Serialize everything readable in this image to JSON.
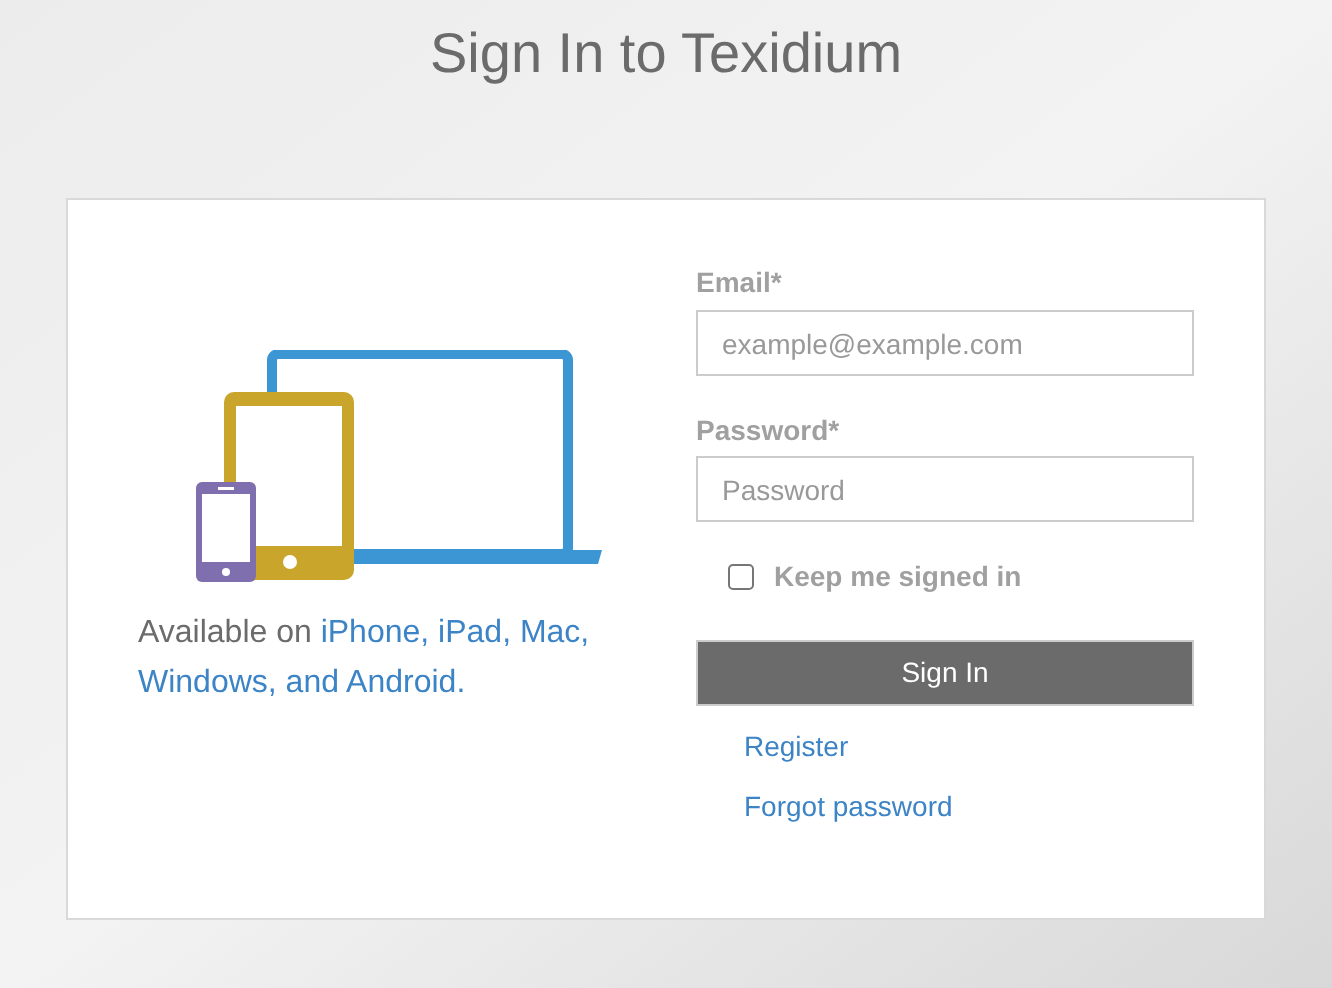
{
  "title": "Sign In to Texidium",
  "availability": {
    "prefix": "Available on ",
    "platforms": "iPhone, iPad, Mac, Windows, and Android."
  },
  "form": {
    "email": {
      "label": "Email*",
      "placeholder": "example@example.com"
    },
    "password": {
      "label": "Password*",
      "placeholder": "Password"
    },
    "keep_signed_in": {
      "label": "Keep me signed in",
      "checked": false
    },
    "submit": "Sign In",
    "links": [
      "Register",
      "Forgot password"
    ]
  }
}
